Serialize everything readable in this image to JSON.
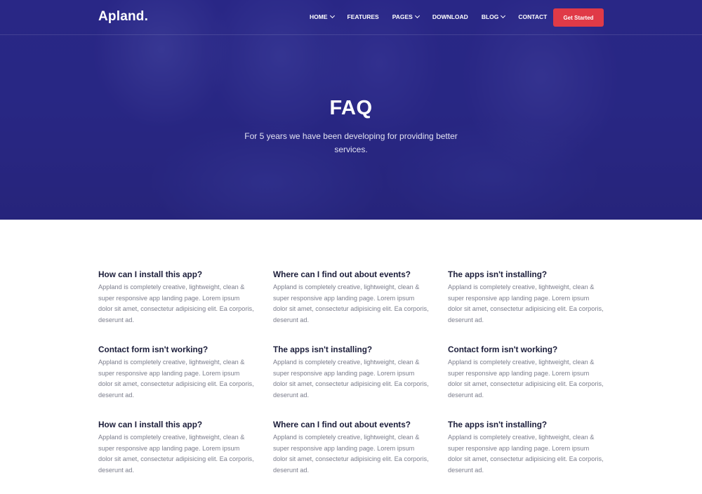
{
  "brand": {
    "logo": "Apland."
  },
  "nav": {
    "items": [
      {
        "label": "HOME",
        "dropdown": true
      },
      {
        "label": "FEATURES",
        "dropdown": false
      },
      {
        "label": "PAGES",
        "dropdown": true
      },
      {
        "label": "DOWNLOAD",
        "dropdown": false
      },
      {
        "label": "BLOG",
        "dropdown": true
      },
      {
        "label": "CONTACT",
        "dropdown": false
      }
    ],
    "cta_label": "Get Started"
  },
  "hero": {
    "title": "FAQ",
    "subtitle": "For 5 years we have been developing for providing better services."
  },
  "faq": {
    "items": [
      {
        "q": "How can I install this app?",
        "a": "Appland is completely creative, lightweight, clean & super responsive app landing page. Lorem ipsum dolor sit amet, consectetur adipisicing elit. Ea corporis, deserunt ad."
      },
      {
        "q": "Where can I find out about events?",
        "a": "Appland is completely creative, lightweight, clean & super responsive app landing page. Lorem ipsum dolor sit amet, consectetur adipisicing elit. Ea corporis, deserunt ad."
      },
      {
        "q": "The apps isn't installing?",
        "a": "Appland is completely creative, lightweight, clean & super responsive app landing page. Lorem ipsum dolor sit amet, consectetur adipisicing elit. Ea corporis, deserunt ad."
      },
      {
        "q": "Contact form isn't working?",
        "a": "Appland is completely creative, lightweight, clean & super responsive app landing page. Lorem ipsum dolor sit amet, consectetur adipisicing elit. Ea corporis, deserunt ad."
      },
      {
        "q": "The apps isn't installing?",
        "a": "Appland is completely creative, lightweight, clean & super responsive app landing page. Lorem ipsum dolor sit amet, consectetur adipisicing elit. Ea corporis, deserunt ad."
      },
      {
        "q": "Contact form isn't working?",
        "a": "Appland is completely creative, lightweight, clean & super responsive app landing page. Lorem ipsum dolor sit amet, consectetur adipisicing elit. Ea corporis, deserunt ad."
      },
      {
        "q": "How can I install this app?",
        "a": "Appland is completely creative, lightweight, clean & super responsive app landing page. Lorem ipsum dolor sit amet, consectetur adipisicing elit. Ea corporis, deserunt ad."
      },
      {
        "q": "Where can I find out about events?",
        "a": "Appland is completely creative, lightweight, clean & super responsive app landing page. Lorem ipsum dolor sit amet, consectetur adipisicing elit. Ea corporis, deserunt ad."
      },
      {
        "q": "The apps isn't installing?",
        "a": "Appland is completely creative, lightweight, clean & super responsive app landing page. Lorem ipsum dolor sit amet, consectetur adipisicing elit. Ea corporis, deserunt ad."
      }
    ]
  },
  "colors": {
    "hero_overlay": "#2c2a86",
    "cta": "#e03a47",
    "heading": "#1b1d3a",
    "body_text": "#7b7d8c"
  }
}
